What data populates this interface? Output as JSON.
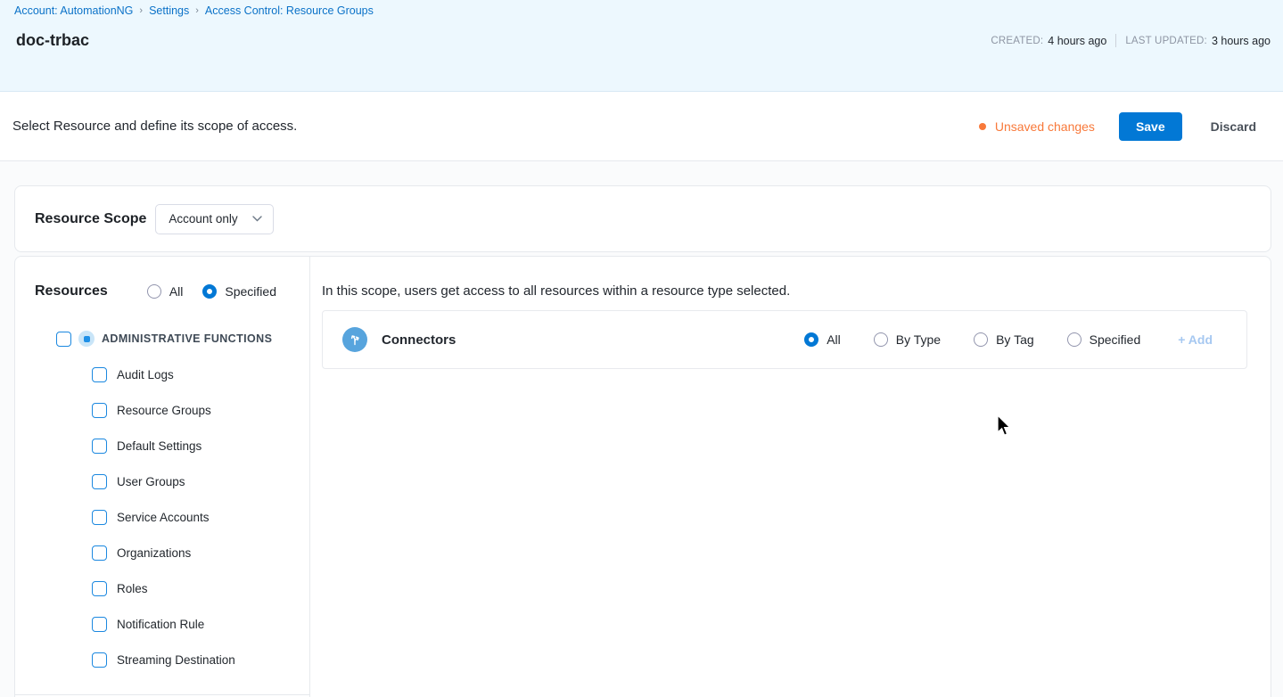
{
  "breadcrumb": {
    "separator": "›",
    "items": [
      "Account: AutomationNG",
      "Settings",
      "Access Control: Resource Groups"
    ]
  },
  "header": {
    "title": "doc-trbac",
    "created_label": "CREATED:",
    "created_value": "4 hours ago",
    "updated_label": "LAST UPDATED:",
    "updated_value": "3 hours ago"
  },
  "toolbar": {
    "description": "Select Resource and define its scope of access.",
    "unsaved_changes": "Unsaved changes",
    "save": "Save",
    "discard": "Discard"
  },
  "resource_scope": {
    "label": "Resource Scope",
    "selected": "Account only"
  },
  "resources_panel": {
    "title": "Resources",
    "scope_options": [
      {
        "label": "All",
        "selected": false
      },
      {
        "label": "Specified",
        "selected": true
      }
    ],
    "group": {
      "label": "ADMINISTRATIVE FUNCTIONS",
      "checked": false
    },
    "items": [
      "Audit Logs",
      "Resource Groups",
      "Default Settings",
      "User Groups",
      "Service Accounts",
      "Organizations",
      "Roles",
      "Notification Rule",
      "Streaming Destination"
    ]
  },
  "main_panel": {
    "description": "In this scope, users get access to all resources within a resource type selected.",
    "row": {
      "name": "Connectors",
      "icon": "fork-arrows-icon",
      "options": [
        {
          "label": "All",
          "selected": true
        },
        {
          "label": "By Type",
          "selected": false
        },
        {
          "label": "By Tag",
          "selected": false
        },
        {
          "label": "Specified",
          "selected": false
        }
      ],
      "add": "+ Add"
    }
  },
  "colors": {
    "accent_blue": "#0278d5",
    "unsaved_orange": "#f8793a",
    "connector_icon_blue": "#57a4dd",
    "breadcrumb_blue": "#0b72c8",
    "header_band": "#edf8fe"
  }
}
